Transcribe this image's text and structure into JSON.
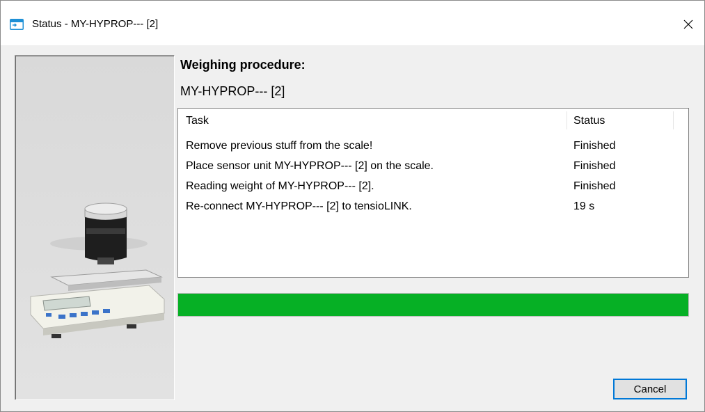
{
  "window": {
    "title": "Status - MY-HYPROP--- [2]"
  },
  "main": {
    "heading": "Weighing procedure:",
    "device": "MY-HYPROP--- [2]"
  },
  "task_list": {
    "columns": [
      "Task",
      "Status"
    ],
    "rows": [
      {
        "task": "Remove previous stuff from the scale!",
        "status": "Finished"
      },
      {
        "task": "Place sensor unit MY-HYPROP--- [2] on the scale.",
        "status": "Finished"
      },
      {
        "task": "Reading weight of MY-HYPROP--- [2].",
        "status": "Finished"
      },
      {
        "task": "Re-connect MY-HYPROP--- [2] to tensioLINK.",
        "status": "19 s"
      }
    ]
  },
  "progress": {
    "value_percent": 100,
    "color": "#06b025"
  },
  "buttons": {
    "cancel": "Cancel"
  },
  "icons": {
    "title_icon": "app-window-icon",
    "close": "close-icon",
    "illustration": "scale-with-sensor-image"
  }
}
